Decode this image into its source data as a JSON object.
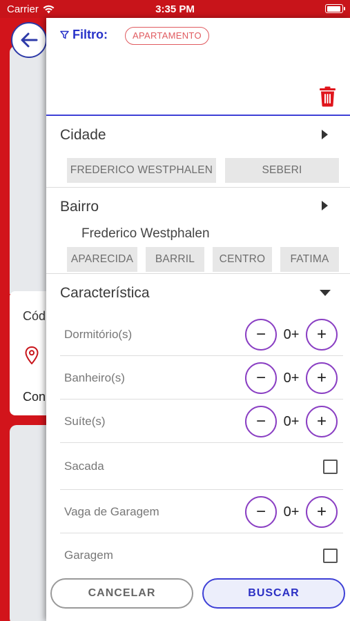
{
  "status_bar": {
    "carrier": "Carrier",
    "time": "3:35 PM"
  },
  "background": {
    "card_text_1": "Cód",
    "card_text_2": "Con"
  },
  "filter": {
    "label": "Filtro:",
    "active_chip": "APARTAMENTO"
  },
  "cidade": {
    "title": "Cidade",
    "options": [
      "FREDERICO WESTPHALEN",
      "SEBERI"
    ]
  },
  "bairro": {
    "title": "Bairro",
    "city": "Frederico Westphalen",
    "options": [
      "APARECIDA",
      "BARRIL",
      "CENTRO",
      "FATIMA"
    ]
  },
  "caracteristica": {
    "title": "Característica",
    "rows": [
      {
        "label": "Dormitório(s)",
        "value": "0+"
      },
      {
        "label": "Banheiro(s)",
        "value": "0+"
      },
      {
        "label": "Suíte(s)",
        "value": "0+"
      },
      {
        "label": "Sacada"
      },
      {
        "label": "Vaga de Garagem",
        "value": "0+"
      },
      {
        "label": "Garagem"
      }
    ]
  },
  "actions": {
    "cancel": "CANCELAR",
    "search": "BUSCAR"
  },
  "colors": {
    "brand_red": "#c8141a",
    "accent_blue": "#2b2fc4",
    "stepper_purple": "#8a3fc3",
    "trash_red": "#e0161d"
  }
}
